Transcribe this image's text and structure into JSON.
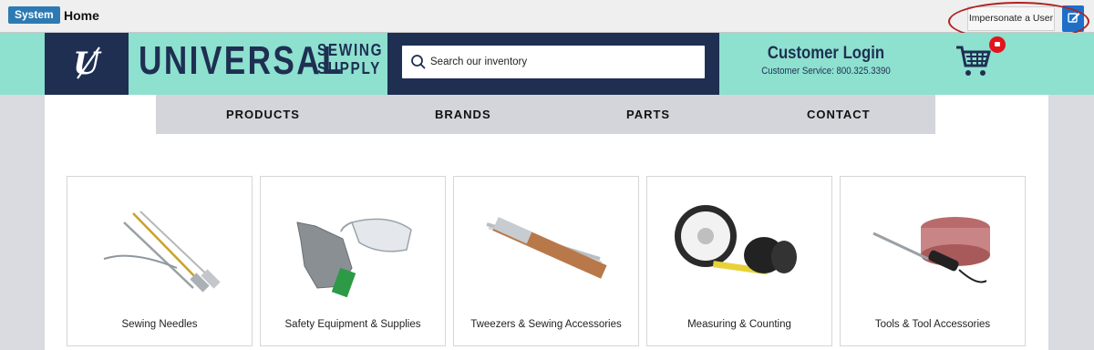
{
  "admin_bar": {
    "system_label": "System",
    "home_label": "Home",
    "impersonate_label": "Impersonate a User",
    "edit_icon": "edit-icon"
  },
  "header": {
    "logo_letter": "U",
    "brand_name": "UNIVERSAL",
    "brand_sub_line1": "SEWING",
    "brand_sub_line2": "SUPPLY",
    "search_placeholder": "Search our inventory",
    "login_title": "Customer Login",
    "customer_service": "Customer Service: 800.325.3390",
    "cart_icon": "cart-icon"
  },
  "nav": {
    "items": [
      {
        "label": "PRODUCTS"
      },
      {
        "label": "BRANDS"
      },
      {
        "label": "PARTS"
      },
      {
        "label": "CONTACT"
      }
    ]
  },
  "categories": [
    {
      "label": "Sewing Needles",
      "icon": "needles-image"
    },
    {
      "label": "Safety Equipment & Supplies",
      "icon": "safety-gear-image"
    },
    {
      "label": "Tweezers & Sewing Accessories",
      "icon": "tweezers-image"
    },
    {
      "label": "Measuring & Counting",
      "icon": "tape-measure-image"
    },
    {
      "label": "Tools & Tool Accessories",
      "icon": "tools-image"
    }
  ],
  "colors": {
    "navy": "#1e2f52",
    "mint": "#8ee0cf",
    "badge_blue": "#2d7ab3",
    "cart_red": "#e2141c",
    "annotation_red": "#b02222"
  }
}
